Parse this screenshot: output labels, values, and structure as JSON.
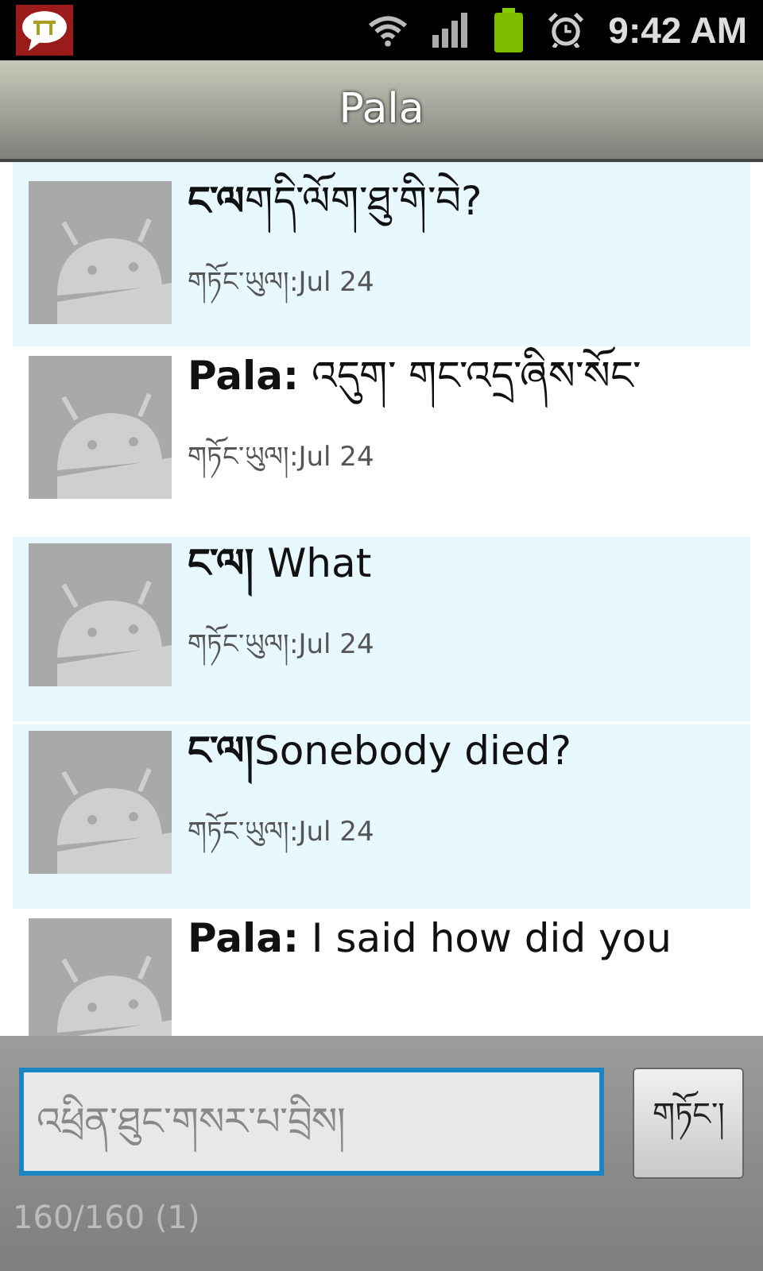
{
  "status_bar": {
    "time": "9:42 AM"
  },
  "title": "Pala",
  "messages": [
    {
      "sender": "ང་ལ",
      "text": "གདི་ལོག་ཐུ་གི་བེ?",
      "timestamp": "གཏོང་ཡུལ།:Jul 24",
      "mine": true
    },
    {
      "sender": "Pala:",
      "text": " འདུག་ གང་འདྲ་ཞིས་སོང་",
      "timestamp": "གཏོང་ཡུལ།:Jul 24",
      "mine": false
    },
    {
      "sender": "ང་ལ།",
      "text": " What",
      "timestamp": "གཏོང་ཡུལ།:Jul 24",
      "mine": true
    },
    {
      "sender": "ང་ལ།",
      "text": "Sonebody died?",
      "timestamp": "གཏོང་ཡུལ།:Jul 24",
      "mine": true
    },
    {
      "sender": "Pala:",
      "text": " I said how did you",
      "mine": false
    }
  ],
  "composer": {
    "placeholder": "འཕྲིན་ཐུང་གསར་པ་བྲིས།",
    "send_label": "གཏོང་།",
    "counter": "160/160 (1)"
  }
}
